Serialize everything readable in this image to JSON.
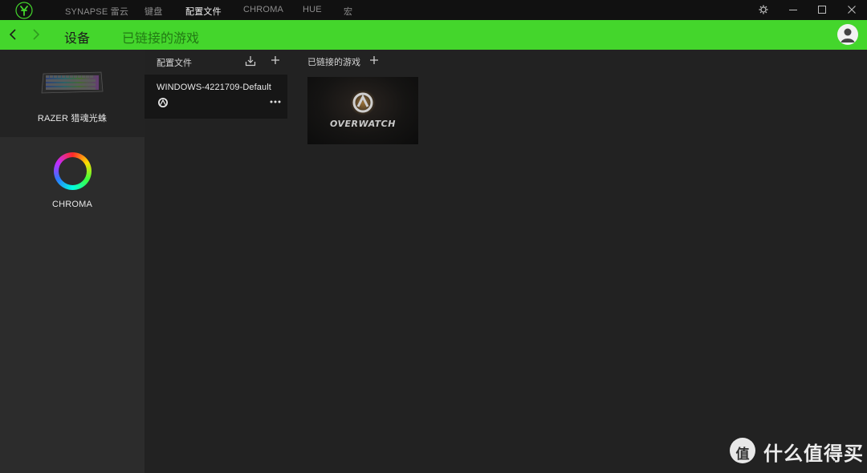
{
  "titlebar": {
    "tabs": [
      {
        "label": "SYNAPSE 雷云",
        "active": false
      },
      {
        "label": "键盘",
        "active": false
      },
      {
        "label": "配置文件",
        "active": true
      },
      {
        "label": "CHROMA",
        "active": false
      },
      {
        "label": "HUE",
        "active": false
      },
      {
        "label": "宏",
        "active": false
      }
    ],
    "icons": [
      "razer-logo-icon",
      "settings-icon",
      "minimize-icon",
      "maximize-icon",
      "close-icon"
    ]
  },
  "header": {
    "devices_label": "设备",
    "linked_games_label": "已链接的游戏",
    "accent_color": "#44d62c"
  },
  "devices": [
    {
      "label": "RAZER 猎魂光蛛",
      "selected": true
    },
    {
      "label": "CHROMA",
      "selected": false
    }
  ],
  "profiles": {
    "title": "配置文件",
    "items": [
      {
        "name": "WINDOWS-4221709-Default"
      }
    ]
  },
  "linked_games": {
    "title": "已链接的游戏",
    "items": [
      {
        "name": "OVERWATCH"
      }
    ]
  },
  "watermark": {
    "icon_text": "值",
    "text": "什么值得买"
  }
}
